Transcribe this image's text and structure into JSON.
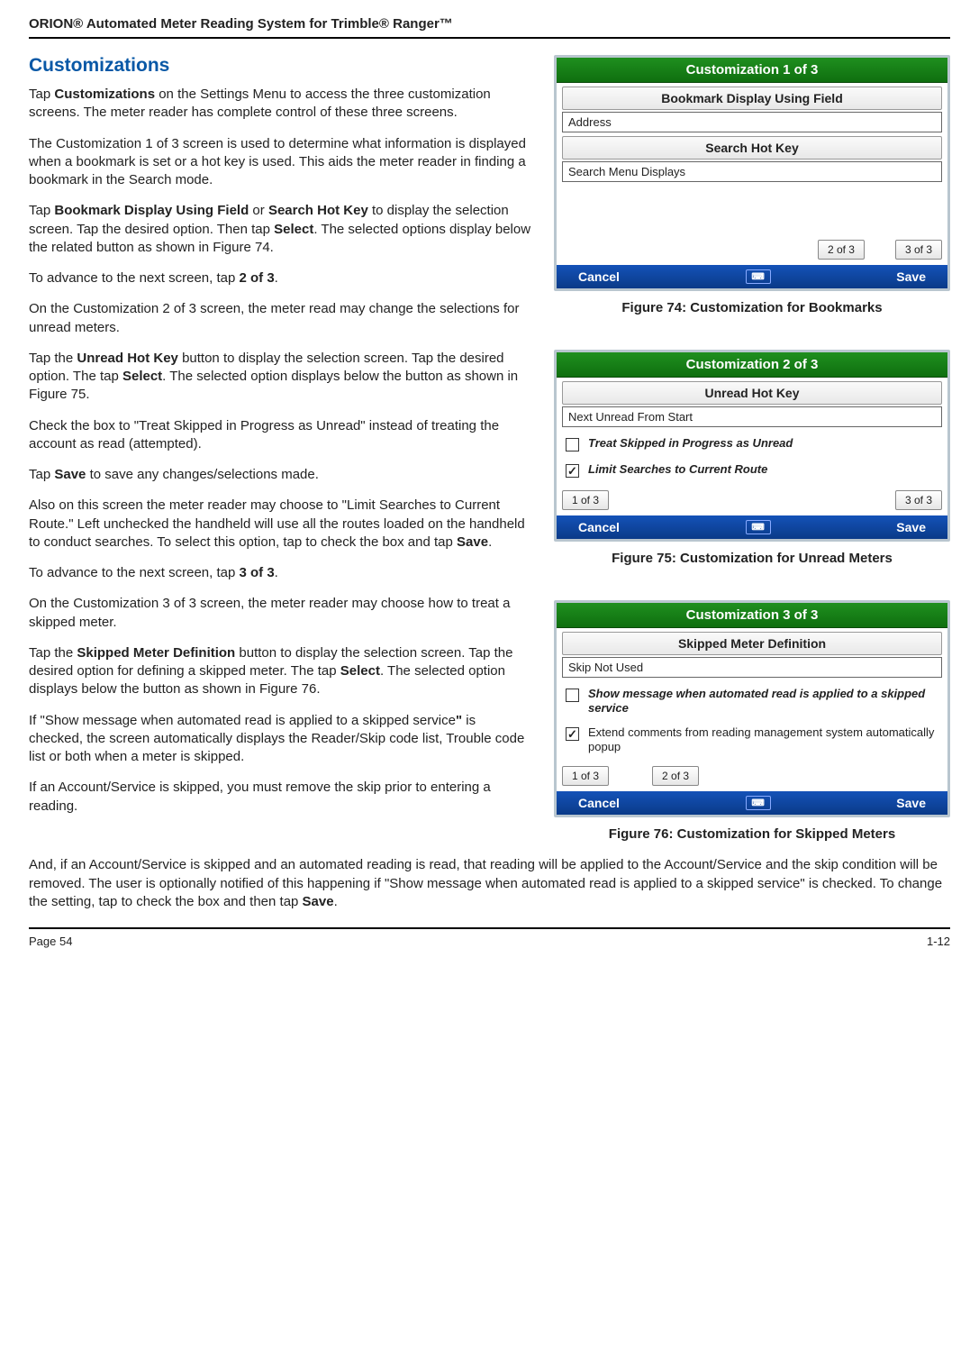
{
  "header": "ORION® Automated Meter Reading System for Trimble® Ranger™",
  "section_title": "Customizations",
  "p1a": "Tap ",
  "p1b": "Customizations",
  "p1c": " on the Settings Menu to access the three customization screens. The meter reader has complete control of these three screens.",
  "p2": "The Customization 1 of 3 screen is used to determine what information is displayed when a bookmark is set or a hot key is used. This aids the meter reader in finding a bookmark in the Search mode.",
  "p3a": "Tap ",
  "p3b": "Bookmark Display Using Field",
  "p3c": " or ",
  "p3d": "Search Hot Key",
  "p3e": " to display the selection screen. Tap the desired option. Then tap ",
  "p3f": "Select",
  "p3g": ". The selected options display below the related button as shown in Figure 74.",
  "p4a": "To advance to the next screen, tap ",
  "p4b": "2 of 3",
  "p4c": ".",
  "p5": "On the Customization 2 of 3 screen, the meter read may change the selections for unread meters.",
  "p6a": "Tap the ",
  "p6b": "Unread Hot Key",
  "p6c": " button to display the selection screen. Tap the desired option. The tap ",
  "p6d": "Select",
  "p6e": ". The selected option displays below the button as shown in Figure 75.",
  "p7": "Check the box to \"Treat Skipped in Progress as Unread\" instead of treating the account as read (attempted).",
  "p8a": "Tap ",
  "p8b": "Save",
  "p8c": " to save any changes/selections made.",
  "p9a": "Also on this screen the meter reader may choose to \"Limit Searches to Current Route.\" Left unchecked the handheld will use all the routes loaded on the handheld to conduct searches. To select this option, tap to check the box and tap ",
  "p9b": "Save",
  "p9c": ".",
  "p10a": "To advance to the next screen, tap ",
  "p10b": "3 of 3",
  "p10c": ".",
  "p11": "On the Customization 3 of 3 screen, the meter reader may choose how to treat a skipped meter.",
  "p12a": "Tap the ",
  "p12b": "Skipped Meter Definition",
  "p12c": " button to display the selection screen. Tap the desired option for defining a skipped meter. The tap ",
  "p12d": "Select",
  "p12e": ". The selected option displays below the button as shown in Figure 76.",
  "p13a": "If \"Show message when automated read is applied to a skipped service",
  "p13b": "\"",
  "p13c": " is checked, the screen automatically displays the Reader/Skip code list, Trouble code list or both when a meter is skipped.",
  "p14": "If an Account/Service is skipped, you must remove the skip prior to entering a reading.",
  "p15a": "And, if an Account/Service is skipped and an automated reading is read, that reading will be applied to the Account/Service and the skip condition will be removed. The user is optionally notified of this happening if \"Show message when automated read is applied to a skipped service\" is checked. To change the setting, tap to check the box and then tap ",
  "p15b": "Save",
  "p15c": ".",
  "fig74": {
    "title": "Customization 1 of 3",
    "field1": "Bookmark Display Using Field",
    "value1": "Address",
    "field2": "Search Hot Key",
    "value2": "Search Menu Displays",
    "nav2": "2 of 3",
    "nav3": "3 of 3",
    "cancel": "Cancel",
    "save": "Save",
    "caption": "Figure 74:  Customization for Bookmarks"
  },
  "fig75": {
    "title": "Customization 2 of 3",
    "field1": "Unread Hot Key",
    "value1": "Next Unread From Start",
    "check1_label": "Treat Skipped in Progress as Unread",
    "check1_checked": "",
    "check2_label": "Limit Searches to Current Route",
    "check2_checked": "✓",
    "nav1": "1 of 3",
    "nav3": "3 of 3",
    "cancel": "Cancel",
    "save": "Save",
    "caption": "Figure 75:  Customization for Unread Meters"
  },
  "fig76": {
    "title": "Customization 3 of 3",
    "field1": "Skipped Meter Definition",
    "value1": "Skip Not Used",
    "check1_label": "Show message when automated read is applied to a skipped service",
    "check1_checked": "",
    "check2_label": "Extend comments from reading management system automatically popup",
    "check2_checked": "✓",
    "nav1": "1 of 3",
    "nav2": "2 of 3",
    "cancel": "Cancel",
    "save": "Save",
    "caption": "Figure 76:  Customization for Skipped Meters"
  },
  "footer_left": "Page 54",
  "footer_right": "1-12"
}
